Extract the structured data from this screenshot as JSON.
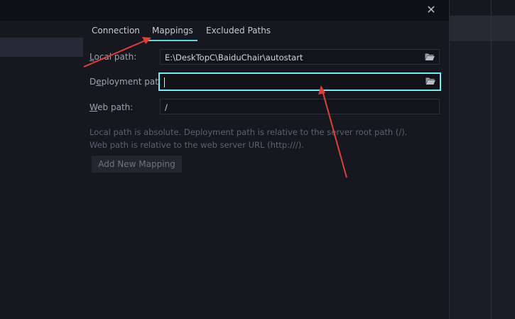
{
  "dialog": {
    "close_icon": "close-icon"
  },
  "tabs": [
    {
      "label": "Connection",
      "active": false
    },
    {
      "label": "Mappings",
      "active": true
    },
    {
      "label": "Excluded Paths",
      "active": false
    }
  ],
  "mappings": {
    "local_path": {
      "label_mnemonic": "L",
      "label_rest": "ocal path:",
      "value": "E:\\DeskTopC\\BaiduChair\\autostart",
      "icon": "folder-icon"
    },
    "deployment_path": {
      "label_pre": "D",
      "label_mnemonic": "e",
      "label_rest": "ployment path:",
      "value": "",
      "icon": "folder-icon"
    },
    "web_path": {
      "label_mnemonic": "W",
      "label_rest": "eb path:",
      "value": "/"
    },
    "hint_line1": "Local path is absolute. Deployment path is relative to the server root path (/).",
    "hint_line2": "Web path is relative to the web server URL (http:///).",
    "add_button_label": "Add New Mapping"
  },
  "colors": {
    "accent": "#5fd6dd",
    "focus_border": "#7be9ef",
    "annotation_arrow": "#e0403a"
  }
}
